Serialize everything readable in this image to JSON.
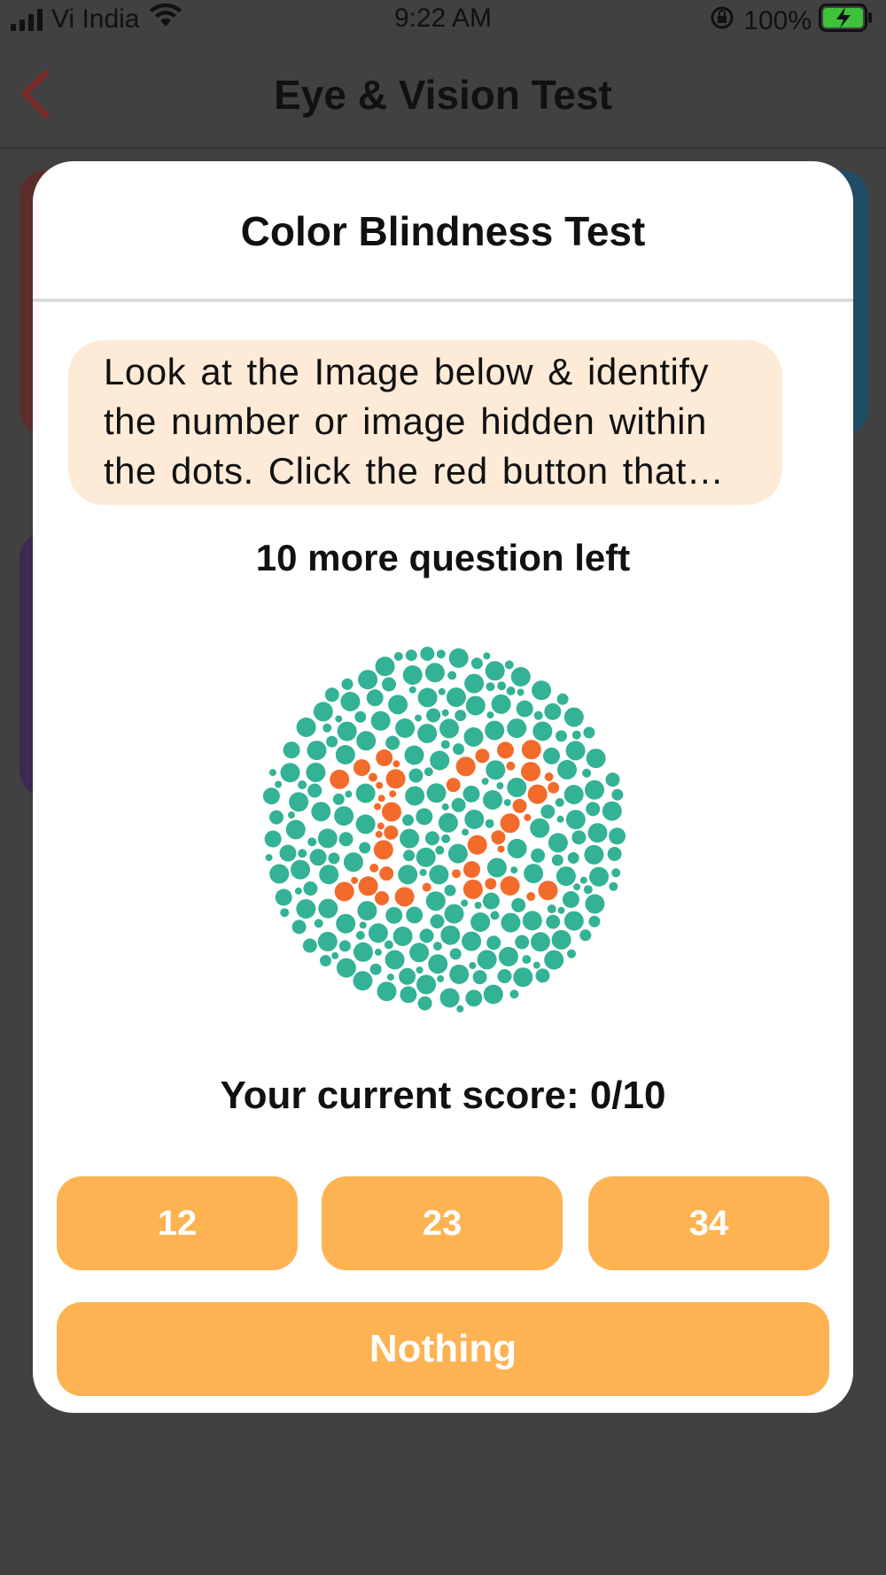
{
  "status_bar": {
    "carrier": "Vi India",
    "time": "9:22 AM",
    "battery": "100%"
  },
  "nav": {
    "title": "Eye & Vision Test",
    "back_icon": "chevron-left-icon"
  },
  "modal": {
    "title": "Color Blindness Test",
    "instruction": "Look at the Image below & identify the number or image hidden within the dots. Click the red button that…",
    "remaining": "10 more question left",
    "plate_number": "12",
    "score": "Your current score: 0/10",
    "options": [
      "12",
      "23",
      "34"
    ],
    "nothing_label": "Nothing"
  },
  "colors": {
    "background_dim": "#414141",
    "accent_button": "#fdb352",
    "instruction_bg": "#fdebd8",
    "back_arrow": "#7a2b2b",
    "plate_dot_green": "#33b295",
    "plate_dot_orange": "#f26b2a"
  }
}
